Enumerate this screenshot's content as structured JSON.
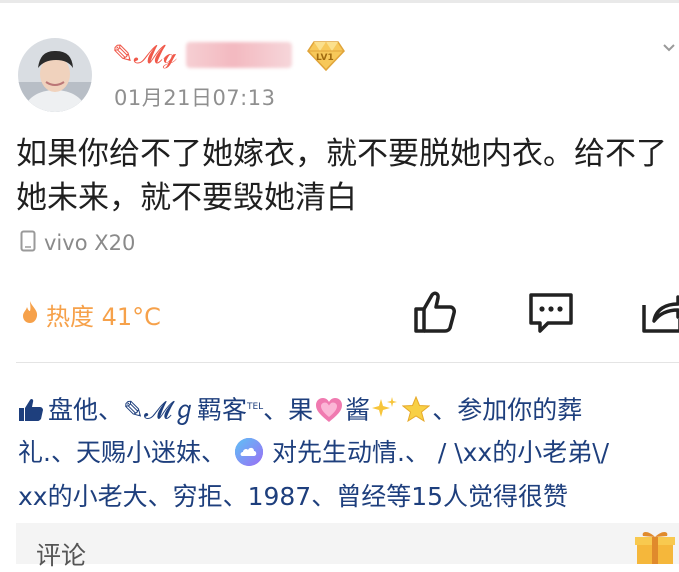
{
  "post": {
    "username_visible": "✎𝓜ℊ",
    "level_badge": "LV1",
    "timestamp": "01月21日07:13",
    "text_line1": "如果你给不了她嫁衣，就不要脱她内衣。给不了",
    "text_line2": "她未来，就不要毁她清白",
    "device": "vivo X20",
    "heat_label": "热度 41°C"
  },
  "likes": {
    "names_line1_a": "盘他、✎𝓜ℊ羁客",
    "tel_mark": "TEL",
    "names_line1_b": "、果",
    "names_line1_c": "酱",
    "names_line1_d": "、参加你的葬",
    "names_line2_a": "礼.、天赐小迷妹、",
    "names_line2_b": "对先生动情.、 / \\xx的小老弟\\/",
    "names_line3": "xx的小老大、穷拒、1987、曾经等15人觉得很赞"
  },
  "comment": {
    "label": "评论"
  },
  "icons": {
    "device": "phone-icon",
    "heat": "flame-icon",
    "like": "thumbs-up-icon",
    "comment": "comment-bubble-icon",
    "share": "share-icon",
    "gift": "gift-icon",
    "more": "chevron-icon"
  },
  "colors": {
    "username": "#f0594a",
    "likes_text": "#1e3f7d",
    "heat": "#f6a14a",
    "secondary": "#8f8f8f"
  }
}
